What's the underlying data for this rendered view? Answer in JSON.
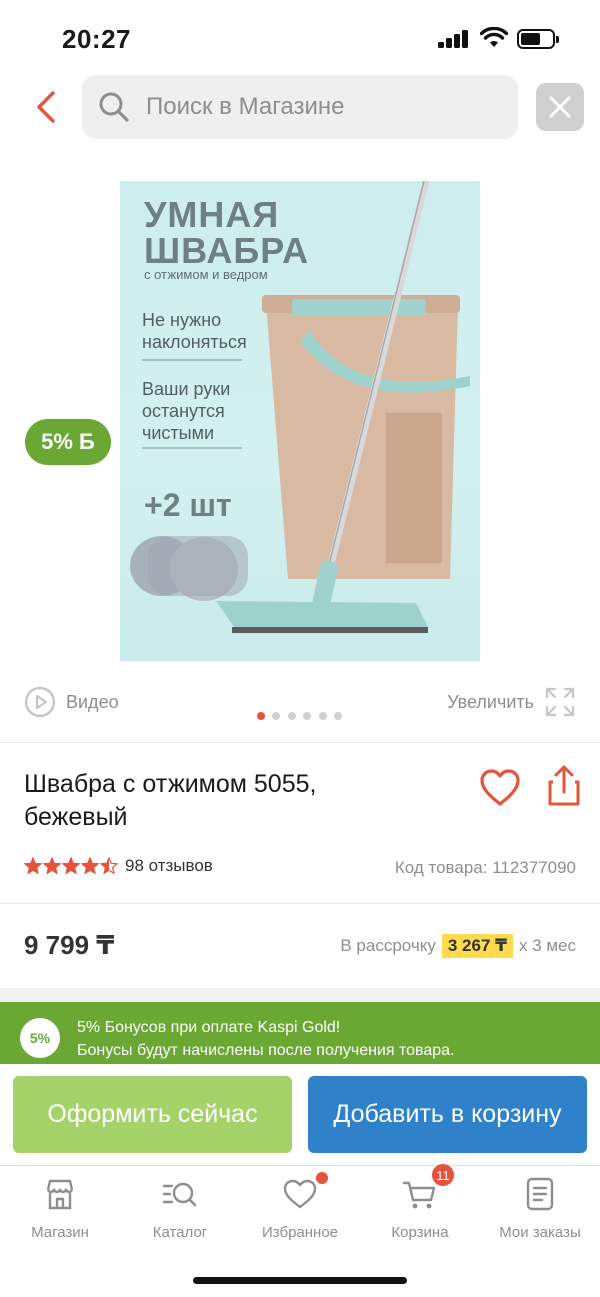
{
  "status_bar": {
    "time": "20:27"
  },
  "search": {
    "placeholder": "Поиск в Магазине",
    "value": ""
  },
  "product_image": {
    "headline_1": "УМНАЯ",
    "headline_2": "ШВАБРА",
    "subheadline": "с отжимом и ведром",
    "feature_1_line_1": "Не нужно",
    "feature_1_line_2": "наклоняться",
    "feature_2_line_1": "Ваши руки",
    "feature_2_line_2": "останутся",
    "feature_2_line_3": "чистыми",
    "extra": "+2 шт"
  },
  "bonus_badge": "5% Б",
  "media": {
    "video_label": "Видео",
    "zoom_label": "Увеличить",
    "slides_total": 6,
    "slide_active": 1
  },
  "product": {
    "title": "Швабра с отжимом 5055, бежевый",
    "rating": 4.5,
    "reviews": "98 отзывов",
    "sku": "Код товара: 112377090",
    "price": "9 799 ₸",
    "installment_prefix": "В рассрочку",
    "installment_amount": "3 267 ₸",
    "installment_suffix": "x 3 мес"
  },
  "promo": {
    "badge": "5%",
    "line_1": "5% Бонусов при оплате Kaspi Gold!",
    "line_2": "Бонусы будут начислены после получения товара."
  },
  "actions": {
    "buy_now": "Оформить сейчас",
    "add_to_cart": "Добавить в корзину"
  },
  "tabs": [
    {
      "label": "Магазин",
      "icon": "store-icon"
    },
    {
      "label": "Каталог",
      "icon": "catalog-search-icon"
    },
    {
      "label": "Избранное",
      "icon": "heart-icon",
      "dot": true
    },
    {
      "label": "Корзина",
      "icon": "cart-icon",
      "badge": "11"
    },
    {
      "label": "Мои заказы",
      "icon": "orders-icon"
    }
  ],
  "colors": {
    "accent_red": "#e5533d",
    "kaspi_green": "#6aa733",
    "button_green": "#a6d26a",
    "button_blue": "#2f82c9",
    "installment_yellow": "#ffdb4d"
  }
}
